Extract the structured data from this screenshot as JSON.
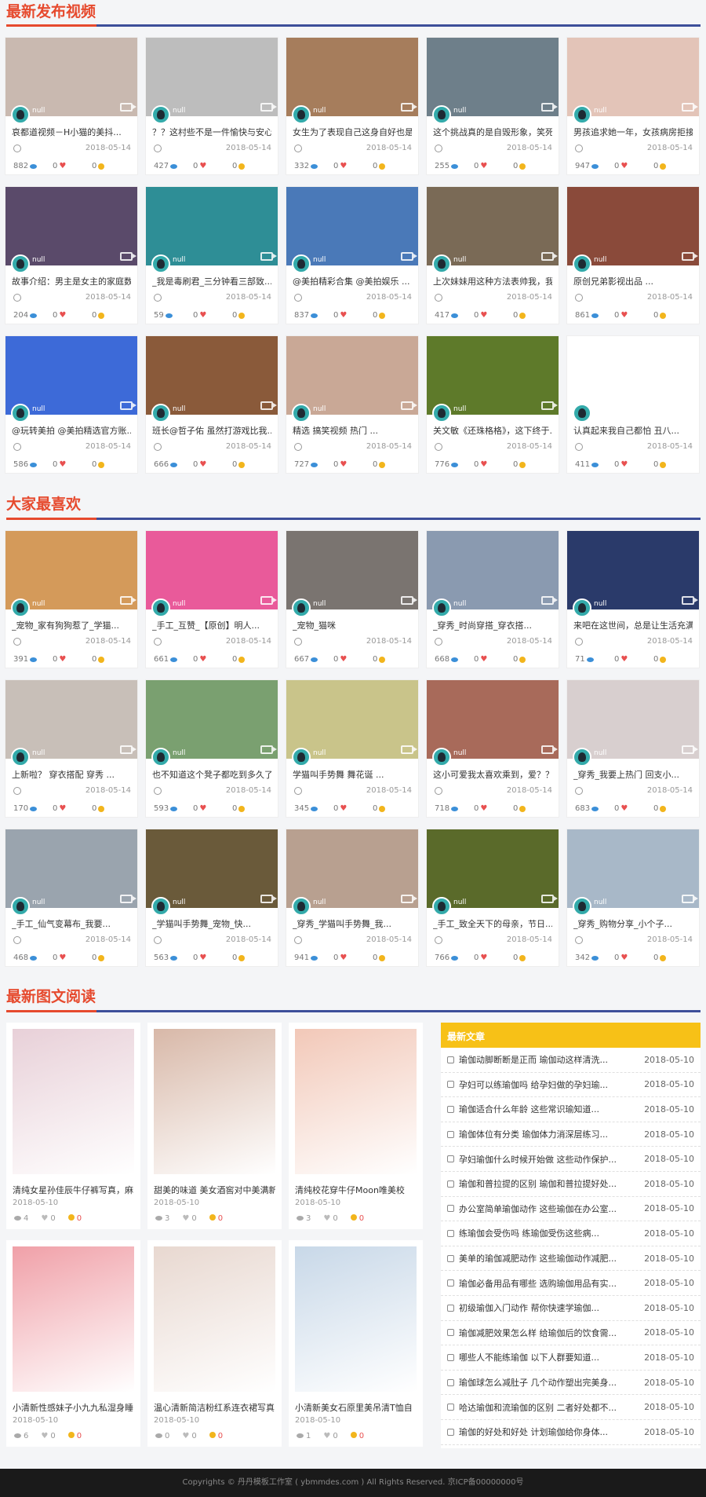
{
  "sections": {
    "latest_videos": "最新发布视频",
    "popular": "大家最喜欢",
    "latest_articles": "最新图文阅读"
  },
  "colors": {
    "accent": "#e64a2e",
    "line_blue": "#3d4f9a",
    "news_header": "#f7c117"
  },
  "latest_videos": [
    {
      "author": "null",
      "title": "哀都道视频－H小猫的美抖...",
      "date": "2018-05-14",
      "views": "882",
      "likes": "0",
      "coins": "0",
      "thumb": "#c9b9b0"
    },
    {
      "author": "null",
      "title": "？？这村些不是一件愉快与安心...",
      "date": "2018-05-14",
      "views": "427",
      "likes": "0",
      "coins": "0",
      "thumb": "#bdbdbd"
    },
    {
      "author": "null",
      "title": "女生为了表现自己这身自好也是...",
      "date": "2018-05-14",
      "views": "332",
      "likes": "0",
      "coins": "0",
      "thumb": "#a67d5c"
    },
    {
      "author": "null",
      "title": "这个挑战真的是自毁形象，笑死...",
      "date": "2018-05-14",
      "views": "255",
      "likes": "0",
      "coins": "0",
      "thumb": "#6e7f8a"
    },
    {
      "author": "null",
      "title": "男孩追求她一年，女孩病房拒接...",
      "date": "2018-05-14",
      "views": "947",
      "likes": "0",
      "coins": "0",
      "thumb": "#e3c4b8"
    },
    {
      "author": "null",
      "title": "故事介绍：男主是女主的家庭数...",
      "date": "2018-05-14",
      "views": "204",
      "likes": "0",
      "coins": "0",
      "thumb": "#5a4a6a"
    },
    {
      "author": "null",
      "title": "_我是毒刷君_三分钟看三部致...",
      "date": "2018-05-14",
      "views": "59",
      "likes": "0",
      "coins": "0",
      "thumb": "#2e8e96"
    },
    {
      "author": "null",
      "title": "@美拍精彩合集 @美拍娱乐 ...",
      "date": "2018-05-14",
      "views": "837",
      "likes": "0",
      "coins": "0",
      "thumb": "#4a79b8"
    },
    {
      "author": "null",
      "title": "上次妹妹用这种方法表帅我，我...",
      "date": "2018-05-14",
      "views": "417",
      "likes": "0",
      "coins": "0",
      "thumb": "#7a6a56"
    },
    {
      "author": "null",
      "title": "原创兄弟影视出品 ...",
      "date": "2018-05-14",
      "views": "861",
      "likes": "0",
      "coins": "0",
      "thumb": "#8a4a3a"
    },
    {
      "author": "null",
      "title": "@玩转美拍 @美拍精选官方账...",
      "date": "2018-05-14",
      "views": "586",
      "likes": "0",
      "coins": "0",
      "thumb": "#3d6ad8"
    },
    {
      "author": "null",
      "title": "班长@哲子佑 虽然打游戏比我...",
      "date": "2018-05-14",
      "views": "666",
      "likes": "0",
      "coins": "0",
      "thumb": "#8a5a3a"
    },
    {
      "author": "null",
      "title": "精选  搞笑视频  热门 ...",
      "date": "2018-05-14",
      "views": "727",
      "likes": "0",
      "coins": "0",
      "thumb": "#c9a896"
    },
    {
      "author": "null",
      "title": "关文敏《还珠格格》，这下终于...",
      "date": "2018-05-14",
      "views": "776",
      "likes": "0",
      "coins": "0",
      "thumb": "#5e7a2a"
    },
    {
      "author": "null",
      "title": "认真起来我自己都怕  丑八...",
      "date": "2018-05-14",
      "views": "411",
      "likes": "0",
      "coins": "0",
      "thumb": "#ffffff"
    }
  ],
  "popular": [
    {
      "author": "null",
      "title": "_宠物_家有狗狗惹了_学猫...",
      "date": "2018-05-14",
      "views": "391",
      "likes": "0",
      "coins": "0",
      "thumb": "#d49a5a"
    },
    {
      "author": "null",
      "title": "_手工_互赞_【原创】明人...",
      "date": "2018-05-14",
      "views": "661",
      "likes": "0",
      "coins": "0",
      "thumb": "#e95a9a"
    },
    {
      "author": "null",
      "title": "_宠物_猫咪",
      "date": "2018-05-14",
      "views": "667",
      "likes": "0",
      "coins": "0",
      "thumb": "#7a7470"
    },
    {
      "author": "null",
      "title": "_穿秀_时尚穿搭_穿衣搭...",
      "date": "2018-05-14",
      "views": "668",
      "likes": "0",
      "coins": "0",
      "thumb": "#8a9ab0"
    },
    {
      "author": "null",
      "title": "来吧在这世间，总是让生活充满...",
      "date": "2018-05-14",
      "views": "71",
      "likes": "0",
      "coins": "0",
      "thumb": "#2a3a6a"
    },
    {
      "author": "null",
      "title": "上新啦？ 穿衣搭配  穿秀 ...",
      "date": "2018-05-14",
      "views": "170",
      "likes": "0",
      "coins": "0",
      "thumb": "#c8bfb8"
    },
    {
      "author": "null",
      "title": "也不知道这个凳子都吃到多久了，都...",
      "date": "2018-05-14",
      "views": "593",
      "likes": "0",
      "coins": "0",
      "thumb": "#7aa070"
    },
    {
      "author": "null",
      "title": "学猫叫手势舞  舞花诞 ...",
      "date": "2018-05-14",
      "views": "345",
      "likes": "0",
      "coins": "0",
      "thumb": "#c9c48a"
    },
    {
      "author": "null",
      "title": "这小可爱我太喜欢乘到，爱？？ ...",
      "date": "2018-05-14",
      "views": "718",
      "likes": "0",
      "coins": "0",
      "thumb": "#a86a5a"
    },
    {
      "author": "null",
      "title": "_穿秀_我要上热门  回支小...",
      "date": "2018-05-14",
      "views": "683",
      "likes": "0",
      "coins": "0",
      "thumb": "#d8cfcf"
    },
    {
      "author": "null",
      "title": "_手工_仙气变幕布_我要...",
      "date": "2018-05-14",
      "views": "468",
      "likes": "0",
      "coins": "0",
      "thumb": "#9aa4ae"
    },
    {
      "author": "null",
      "title": "_学猫叫手势舞_宠物_快...",
      "date": "2018-05-14",
      "views": "563",
      "likes": "0",
      "coins": "0",
      "thumb": "#6a5a3a"
    },
    {
      "author": "null",
      "title": "_穿秀_学猫叫手势舞_我...",
      "date": "2018-05-14",
      "views": "941",
      "likes": "0",
      "coins": "0",
      "thumb": "#b8a090"
    },
    {
      "author": "null",
      "title": "_手工_致全天下的母亲，节日...",
      "date": "2018-05-14",
      "views": "766",
      "likes": "0",
      "coins": "0",
      "thumb": "#5a6a2a"
    },
    {
      "author": "null",
      "title": "_穿秀_购物分享_小个子...",
      "date": "2018-05-14",
      "views": "342",
      "likes": "0",
      "coins": "0",
      "thumb": "#a8b8c8"
    }
  ],
  "articles": [
    {
      "title": "清纯女星孙佳辰牛仔裤写真，麻",
      "date": "2018-05-10",
      "views": "4",
      "likes": "0",
      "coins": "0",
      "thumb": "#e8d0d8"
    },
    {
      "title": "甜美的味道 美女酒窖对中美满新",
      "date": "2018-05-10",
      "views": "3",
      "likes": "0",
      "coins": "0",
      "thumb": "#d8b8a8"
    },
    {
      "title": "清纯校花穿牛仔Moon唯美校",
      "date": "2018-05-10",
      "views": "3",
      "likes": "0",
      "coins": "0",
      "thumb": "#f2c8b8"
    },
    {
      "title": "小清新性感妹子小九九私湿身睡",
      "date": "2018-05-10",
      "views": "6",
      "likes": "0",
      "coins": "0",
      "thumb": "#f0a0a8"
    },
    {
      "title": "温心清新简洁粉红系连衣裙写真",
      "date": "2018-05-10",
      "views": "0",
      "likes": "0",
      "coins": "0",
      "thumb": "#e8d8d0"
    },
    {
      "title": "小清新美女石原里美吊清T恤自",
      "date": "2018-05-10",
      "views": "1",
      "likes": "0",
      "coins": "0",
      "thumb": "#c8d8e8"
    }
  ],
  "news": {
    "header": "最新文章",
    "items": [
      {
        "title": "瑜伽动脚断断是正而 瑜伽动这样清洗...",
        "date": "2018-05-10"
      },
      {
        "title": "孕妇可以练瑜伽吗 给孕妇做的孕妇瑜...",
        "date": "2018-05-10"
      },
      {
        "title": "瑜伽适合什么年龄 这些常识瑜知道...",
        "date": "2018-05-10"
      },
      {
        "title": "瑜伽体位有分类 瑜伽体力消深层练习...",
        "date": "2018-05-10"
      },
      {
        "title": "孕妇瑜伽什么时候开始做 这些动作保护...",
        "date": "2018-05-10"
      },
      {
        "title": "瑜伽和普拉提的区别 瑜伽和普拉提好处...",
        "date": "2018-05-10"
      },
      {
        "title": "办公室简单瑜伽动作 这些瑜伽在办公室...",
        "date": "2018-05-10"
      },
      {
        "title": "练瑜伽会受伤吗 练瑜伽受伤这些病...",
        "date": "2018-05-10"
      },
      {
        "title": "美单的瑜伽减肥动作 这些瑜伽动作减肥...",
        "date": "2018-05-10"
      },
      {
        "title": "瑜伽必备用品有哪些 选购瑜伽用品有实...",
        "date": "2018-05-10"
      },
      {
        "title": "初级瑜伽入门动作 帮你快速学瑜伽...",
        "date": "2018-05-10"
      },
      {
        "title": "瑜伽减肥效果怎么样 给瑜伽后的饮食需...",
        "date": "2018-05-10"
      },
      {
        "title": "哪些人不能练瑜伽 以下人群要知道...",
        "date": "2018-05-10"
      },
      {
        "title": "瑜伽球怎么减肚子 几个动作塑出完美身...",
        "date": "2018-05-10"
      },
      {
        "title": "哈达瑜伽和流瑜伽的区别 二者好处都不...",
        "date": "2018-05-10"
      },
      {
        "title": "瑜伽的好处和好处 计划瑜伽给你身体...",
        "date": "2018-05-10"
      }
    ]
  },
  "footer": "Copyrights © 丹丹模板工作室 ( ybmmdes.com )  All Rights Reserved. 京ICP备00000000号"
}
